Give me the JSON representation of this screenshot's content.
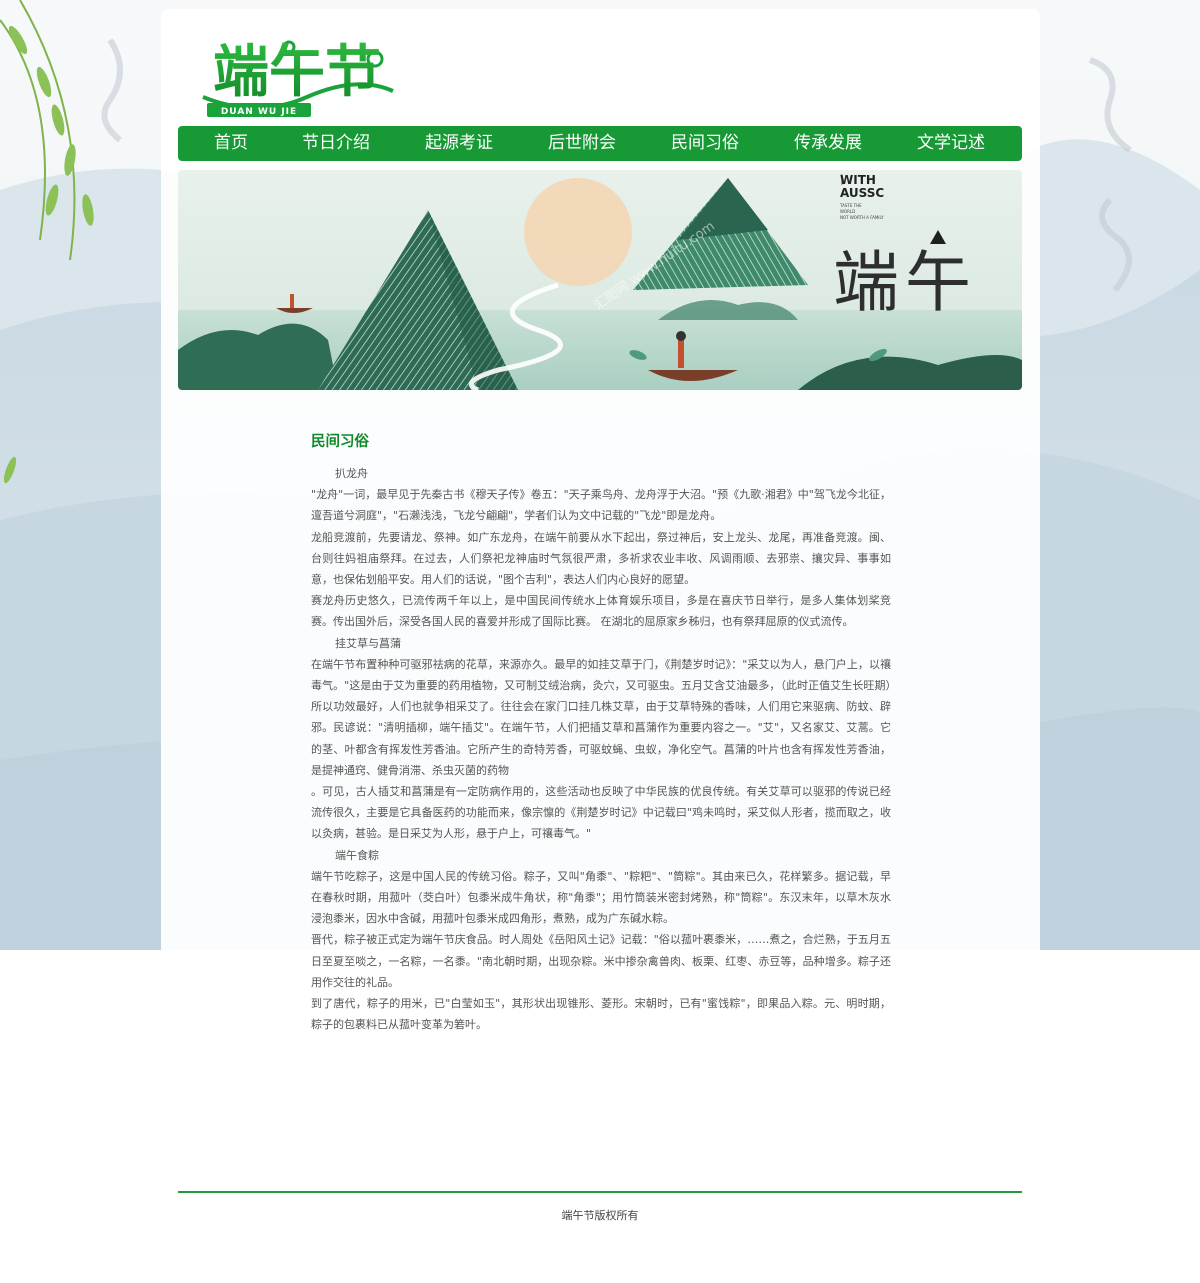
{
  "logo": {
    "title": "端午节",
    "subtitle": "DUAN WU JIE"
  },
  "nav": {
    "items": [
      {
        "label": "首页"
      },
      {
        "label": "节日介绍"
      },
      {
        "label": "起源考证"
      },
      {
        "label": "后世附会"
      },
      {
        "label": "民间习俗"
      },
      {
        "label": "传承发展"
      },
      {
        "label": "文学记述"
      }
    ]
  },
  "banner": {
    "tag_line1": "WITH",
    "tag_line2": "AUSSC",
    "tag_small1": "TASTE THE",
    "tag_small2": "WORLD",
    "tag_small3": "NOT WORTH A FAMILY",
    "big_text": "端午",
    "watermark": "汇图网 www.huitu.com"
  },
  "colors": {
    "brand_green": "#179a35",
    "title_green": "#108a28",
    "body_text": "#555555"
  },
  "content": {
    "title": "民间习俗",
    "paragraphs": [
      {
        "text": "扒龙舟",
        "subhead": true
      },
      {
        "text": "\"龙舟\"一词，最早见于先秦古书《穆天子传》卷五：\"天子乘鸟舟、龙舟浮于大沼。\"预《九歌·湘君》中\"驾飞龙今北征，邅吾道兮洞庭\"，\"石濑浅浅，飞龙兮翩翩\"，学者们认为文中记载的\"飞龙\"即是龙舟。"
      },
      {
        "text": "龙船竞渡前，先要请龙、祭神。如广东龙舟，在端午前要从水下起出，祭过神后，安上龙头、龙尾，再准备竞渡。闽、台则往妈祖庙祭拜。在过去，人们祭祀龙神庙时气氛很严肃，多祈求农业丰收、风调雨顺、去邪祟、攘灾异、事事如意，也保佑划船平安。用人们的话说，\"图个吉利\"，表达人们内心良好的愿望。"
      },
      {
        "text": "赛龙舟历史悠久，已流传两千年以上，是中国民间传统水上体育娱乐项目，多是在喜庆节日举行，是多人集体划桨竞赛。传出国外后，深受各国人民的喜爱并形成了国际比赛。 在湖北的屈原家乡秭归，也有祭拜屈原的仪式流传。"
      },
      {
        "text": "挂艾草与菖蒲",
        "subhead": true
      },
      {
        "text": "在端午节布置种种可驱邪祛病的花草，来源亦久。最早的如挂艾草于门，《荆楚岁时记》：\"采艾以为人，悬门户上，以禳毒气。\"这是由于艾为重要的药用植物，又可制艾绒治病，灸穴，又可驱虫。五月艾含艾油最多，（此时正值艾生长旺期）所以功效最好，人们也就争相采艾了。往往会在家门口挂几株艾草，由于艾草特殊的香味，人们用它来驱病、防蚊、辟邪。民谚说：\"清明插柳，端午插艾\"。在端午节，人们把插艾草和菖蒲作为重要内容之一。\"艾\"，又名家艾、艾蒿。它的茎、叶都含有挥发性芳香油。它所产生的奇特芳香，可驱蚊蝇、虫蚁，净化空气。菖蒲的叶片也含有挥发性芳香油，是提神通窍、健骨消滞、杀虫灭菌的药物"
      },
      {
        "text": "。可见，古人插艾和菖蒲是有一定防病作用的，这些活动也反映了中华民族的优良传统。有关艾草可以驱邪的传说已经流传很久，主要是它具备医药的功能而来，像宗懔的《荆楚岁时记》中记载曰\"鸡未鸣时，采艾似人形者，揽而取之，收以灸病，甚验。是日采艾为人形，悬于户上，可禳毒气。\""
      },
      {
        "text": "端午食粽",
        "subhead": true
      },
      {
        "text": "端午节吃粽子，这是中国人民的传统习俗。粽子，又叫\"角黍\"、\"粽粑\"、\"筒粽\"。其由来已久，花样繁多。据记载，早在春秋时期，用菰叶（茭白叶）包黍米成牛角状，称\"角黍\"；用竹筒装米密封烤熟，称\"筒粽\"。东汉末年，以草木灰水浸泡黍米，因水中含碱，用菰叶包黍米成四角形，煮熟，成为广东碱水粽。"
      },
      {
        "text": "晋代，粽子被正式定为端午节庆食品。时人周处《岳阳风土记》记载：\"俗以菰叶裹黍米，……煮之，合烂熟，于五月五日至夏至啖之，一名粽，一名黍。\"南北朝时期，出现杂粽。米中掺杂禽兽肉、板栗、红枣、赤豆等，品种增多。粽子还用作交往的礼品。"
      },
      {
        "text": "到了唐代，粽子的用米，已\"白莹如玉\"，其形状出现锥形、菱形。宋朝时，已有\"蜜饯粽\"，即果品入粽。元、明时期，粽子的包裹料已从菰叶变革为箬叶。"
      }
    ]
  },
  "footer": {
    "copyright": "端午节版权所有"
  }
}
